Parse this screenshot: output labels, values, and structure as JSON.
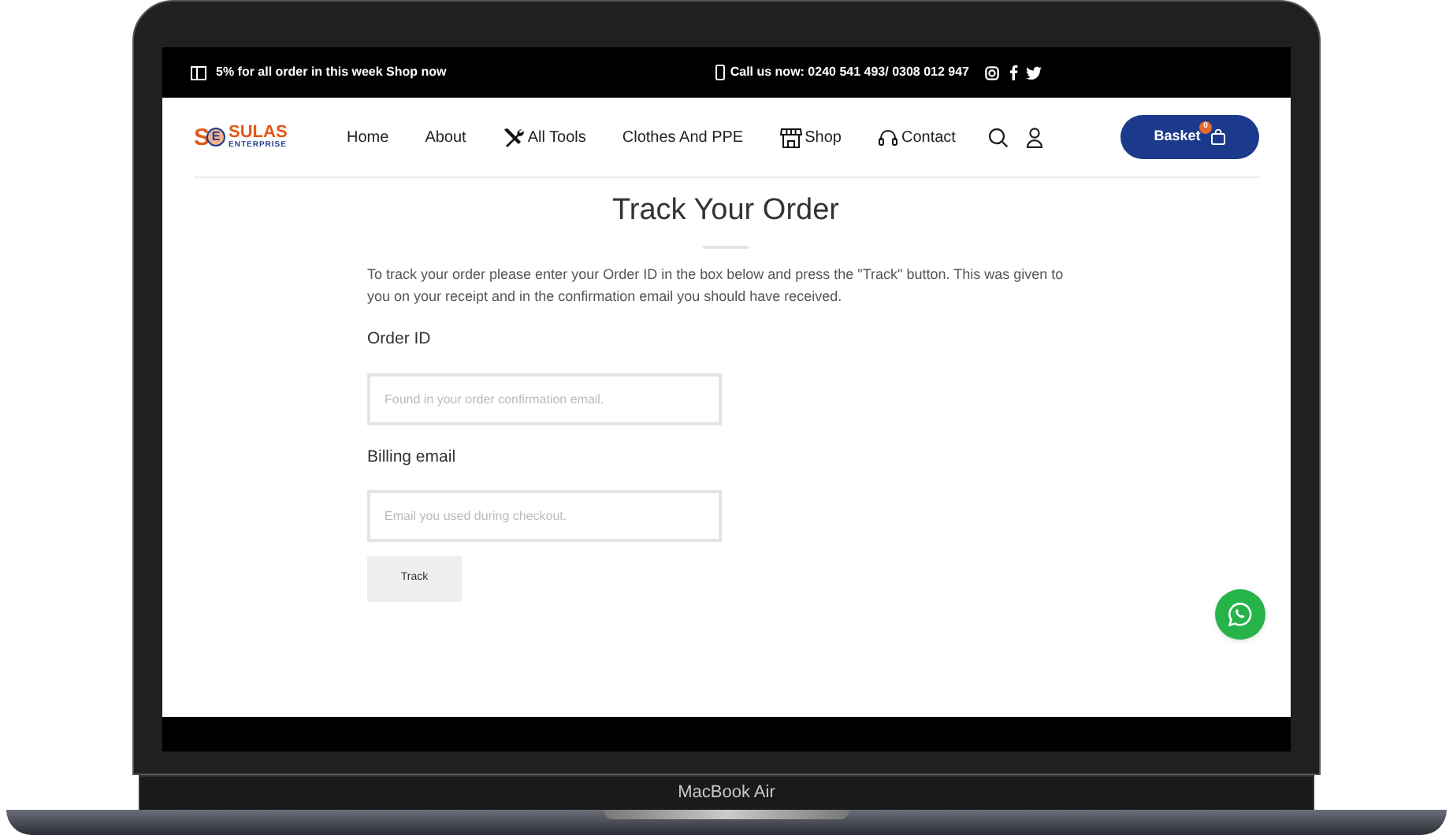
{
  "promo_bar": {
    "offer": "5% for all order in this week Shop now",
    "phone": "Call us now: 0240 541 493/ 0308 012 947"
  },
  "logo": {
    "mark_left": "S",
    "mark_right": "E",
    "name": "SULAS",
    "tagline": "ENTERPRISE"
  },
  "nav": [
    {
      "label": "Home"
    },
    {
      "label": "About"
    },
    {
      "label": "All Tools",
      "kind": "tools"
    },
    {
      "label": "Clothes And PPE"
    },
    {
      "label": "Shop",
      "kind": "store"
    },
    {
      "label": "Contact",
      "kind": "headset"
    }
  ],
  "basket": {
    "label": "Basket",
    "count": "0"
  },
  "page": {
    "title": "Track Your Order",
    "intro": "To track your order please enter your Order ID in the box below and press the \"Track\" button. This was given to you on your receipt and in the confirmation email you should have received.",
    "fields": [
      {
        "label": "Order ID",
        "placeholder": "Found in your order confirmation email."
      },
      {
        "label": "Billing email",
        "placeholder": "Email you used during checkout."
      }
    ],
    "submit": "Track"
  },
  "device": {
    "label": "MacBook Air"
  }
}
